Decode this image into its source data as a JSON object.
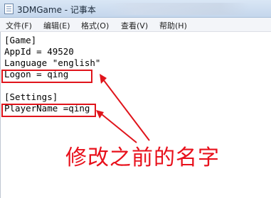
{
  "window": {
    "title": "3DMGame - 记事本"
  },
  "menu": [
    {
      "label": "文件(F)"
    },
    {
      "label": "编辑(E)"
    },
    {
      "label": "格式(O)"
    },
    {
      "label": "查看(V)"
    },
    {
      "label": "帮助(H)"
    }
  ],
  "editor": {
    "lines": [
      "[Game]",
      "AppId = 49520",
      "Language \"english\"",
      "Logon = qing",
      "",
      "[Settings]",
      "PlayerName =qing"
    ]
  },
  "annotation": {
    "text": "修改之前的名字",
    "color": "#e8101b"
  },
  "icons": {
    "app": "notepad-icon"
  }
}
